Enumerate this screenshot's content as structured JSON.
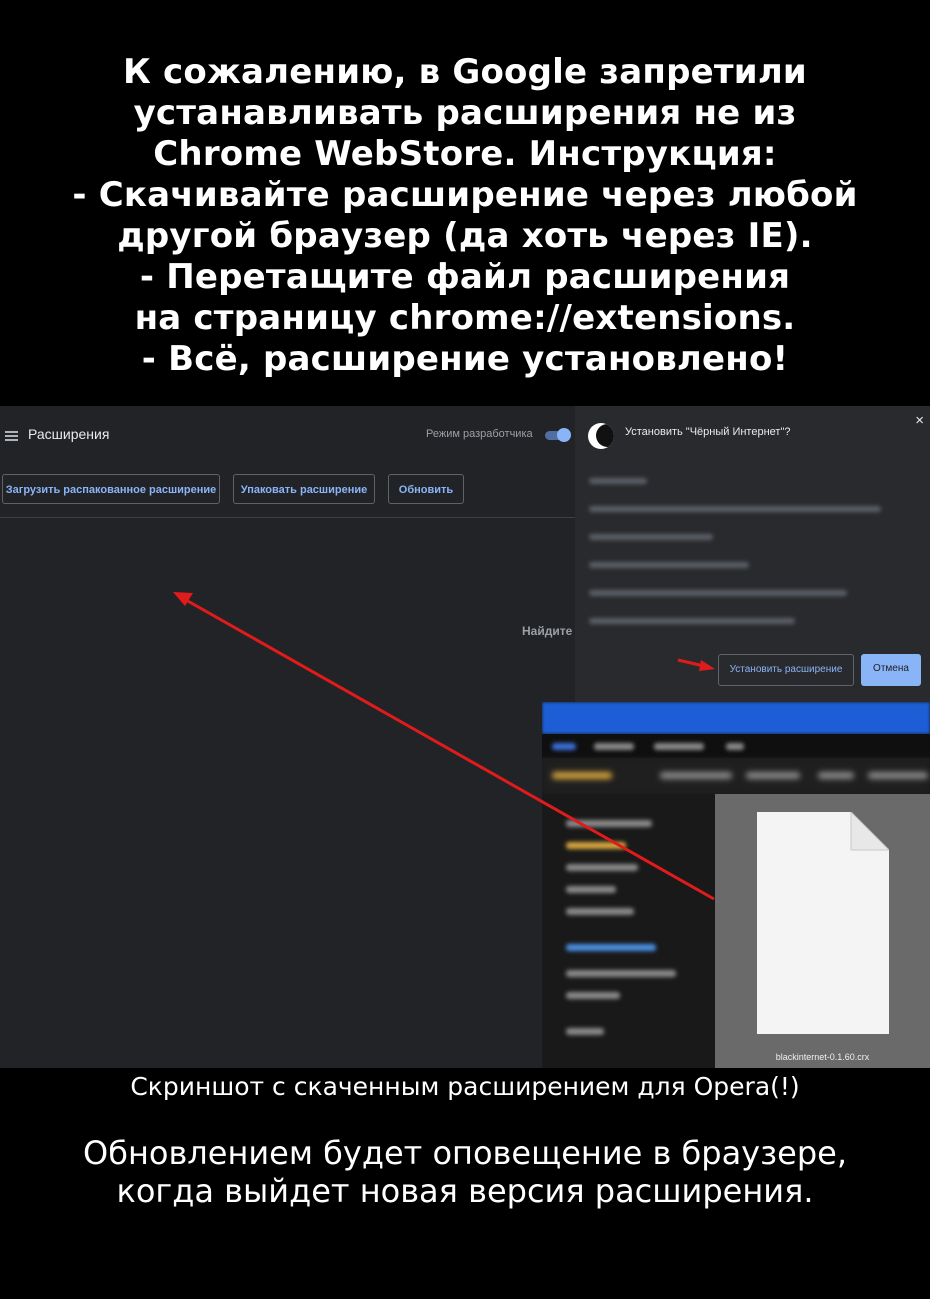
{
  "intro": {
    "lines": [
      "К сожалению, в Google запретили",
      "устанавливать расширения не из",
      "Chrome WebStore. Инструкция:",
      "- Скачивайте расширение через любой",
      "другой  браузер (да хоть через IE).",
      "- Перетащите файл расширения",
      "на страницу chrome://extensions.",
      "- Всё, расширение установлено!"
    ]
  },
  "screenshot": {
    "page_title": "Расширения",
    "menu_icon": "hamburger-icon",
    "dev_mode_label": "Режим разработчика",
    "dev_mode_on": true,
    "buttons": {
      "load_unpacked": "Загрузить распакованное расширение",
      "pack": "Упаковать расширение",
      "update": "Обновить"
    },
    "find_label": "Найдите",
    "dialog": {
      "close_symbol": "×",
      "icon": "black-moon-icon",
      "title": "Установить \"Чёрный Интернет\"?",
      "install_button": "Установить расширение",
      "cancel_button": "Отмена"
    },
    "explorer": {
      "file_name": "blackinternet-0.1.60.crx"
    },
    "arrow_color": "#e01b1b",
    "accent": "#8ab4f8"
  },
  "captions": {
    "screenshot_note": "Скриншот с скаченным расширением для Opera(!)",
    "update_line_1": "Обновлением будет оповещение в браузере,",
    "update_line_2": "когда выйдет новая версия расширения."
  }
}
